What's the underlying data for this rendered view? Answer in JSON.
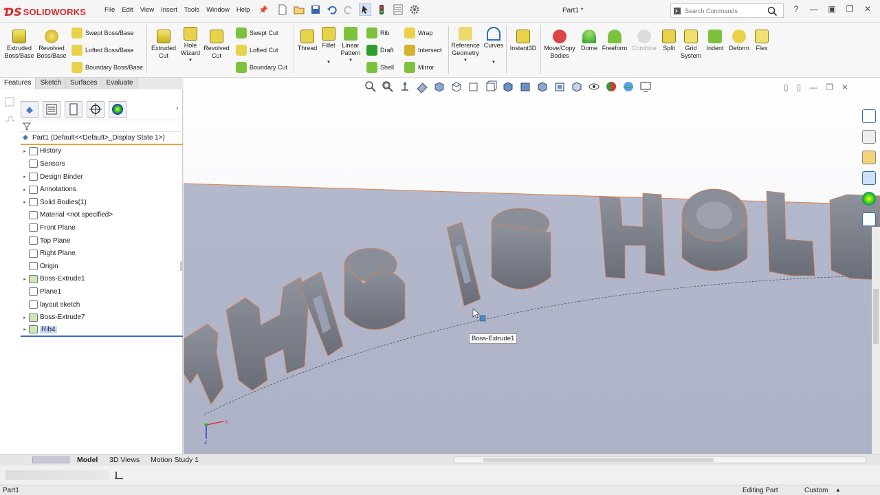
{
  "app": {
    "logo": "SOLIDWORKS",
    "document_title": "Part1 *",
    "menus": [
      "File",
      "Edit",
      "View",
      "Insert",
      "Tools",
      "Window",
      "Help"
    ],
    "search_placeholder": "Search Commands"
  },
  "ribbon": {
    "extruded_boss": [
      "Extruded",
      "Boss/Base"
    ],
    "revolved_boss": [
      "Revolved",
      "Boss/Base"
    ],
    "swept_boss": "Swept Boss/Base",
    "lofted_boss": "Lofted Boss/Base",
    "boundary_boss": "Boundary Boss/Base",
    "extruded_cut": [
      "Extruded",
      "Cut"
    ],
    "hole_wizard": [
      "Hole",
      "Wizard"
    ],
    "revolved_cut": [
      "Revolved",
      "Cut"
    ],
    "swept_cut": "Swept Cut",
    "lofted_cut": "Lofted Cut",
    "boundary_cut": "Boundary Cut",
    "thread": "Thread",
    "fillet": "Fillet",
    "linear_pattern": [
      "Linear",
      "Pattern"
    ],
    "rib": "Rib",
    "wrap": "Wrap",
    "draft": "Draft",
    "intersect": "Intersect",
    "shell": "Shell",
    "mirror": "Mirror",
    "reference_geometry": [
      "Reference",
      "Geometry"
    ],
    "curves": "Curves",
    "instant3d": "Instant3D",
    "move_copy": [
      "Move/Copy",
      "Bodies"
    ],
    "dome": "Dome",
    "freeform": "Freeform",
    "combine": "Combine",
    "split": "Split",
    "grid_system": [
      "Grid",
      "System"
    ],
    "indent": "Indent",
    "deform": "Deform",
    "flex": "Flex"
  },
  "tabs": [
    "Features",
    "Sketch",
    "Surfaces",
    "Evaluate"
  ],
  "tree": {
    "root": "Part1  (Default<<Default>_Display State 1>)",
    "items": [
      {
        "label": "History",
        "expand": true
      },
      {
        "label": "Sensors",
        "expand": false
      },
      {
        "label": "Design Binder",
        "expand": true
      },
      {
        "label": "Annotations",
        "expand": true
      },
      {
        "label": "Solid Bodies(1)",
        "expand": true
      },
      {
        "label": "Material <not specified>",
        "expand": false
      },
      {
        "label": "Front Plane",
        "expand": false
      },
      {
        "label": "Top Plane",
        "expand": false
      },
      {
        "label": "Right Plane",
        "expand": false
      },
      {
        "label": "Origin",
        "expand": false
      },
      {
        "label": "Boss-Extrude1",
        "expand": true
      },
      {
        "label": "Plane1",
        "expand": false
      },
      {
        "label": "layout sketch",
        "expand": false
      },
      {
        "label": "Boss-Extrude7",
        "expand": true
      },
      {
        "label": "Rib4",
        "expand": true
      }
    ]
  },
  "viewport": {
    "tooltip": "Boss-Extrude1",
    "triad_x": "X",
    "triad_z": "Z",
    "model_text": "THIS IS HOLE"
  },
  "bottom_tabs": [
    "Model",
    "3D Views",
    "Motion Study 1"
  ],
  "status": {
    "left": "Part1",
    "editing": "Editing Part",
    "units": "Custom"
  },
  "colors": {
    "brand": "#d8262a",
    "viewport_top": "#ffffff",
    "viewport_floor": "#b0b4c8",
    "selection": "#c8dcf8"
  }
}
